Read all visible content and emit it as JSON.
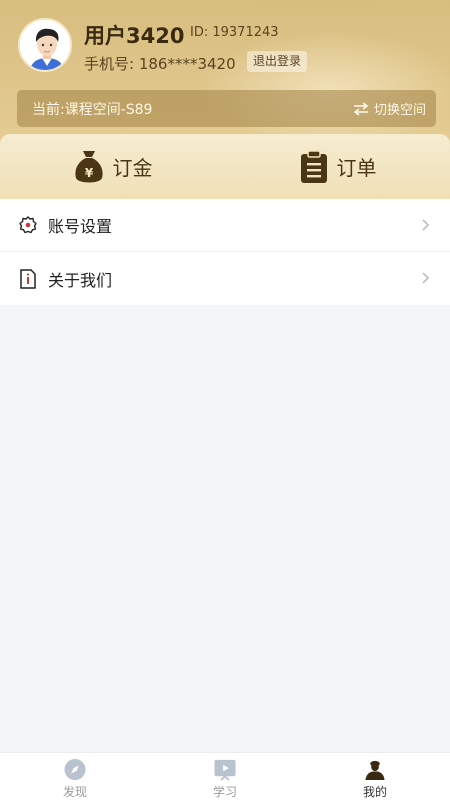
{
  "profile": {
    "name": "用户3420",
    "id_text": "ID: 19371243",
    "phone_text": "手机号: 186****3420",
    "logout_label": "退出登录"
  },
  "space": {
    "current_text": "当前:课程空间-S89",
    "switch_label": "切换空间"
  },
  "quick_tabs": [
    {
      "label": "订金",
      "icon": "money-bag-icon"
    },
    {
      "label": "订单",
      "icon": "clipboard-icon"
    }
  ],
  "menu": [
    {
      "label": "账号设置",
      "icon": "gear-icon"
    },
    {
      "label": "关于我们",
      "icon": "info-doc-icon"
    }
  ],
  "bottom_nav": [
    {
      "label": "发现",
      "icon": "compass-icon",
      "active": false
    },
    {
      "label": "学习",
      "icon": "video-icon",
      "active": false
    },
    {
      "label": "我的",
      "icon": "user-icon",
      "active": true
    }
  ],
  "colors": {
    "header": "#d8bd7f",
    "accent_dark": "#4a3615",
    "inactive": "#9a9a9a"
  }
}
